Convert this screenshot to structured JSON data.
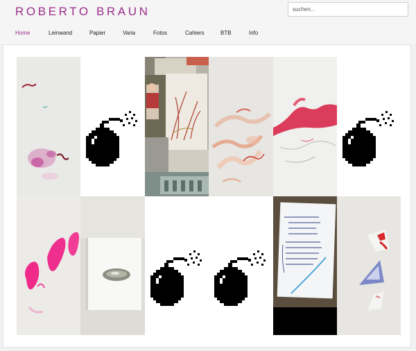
{
  "site": {
    "title": "ROBERTO BRAUN",
    "search_placeholder": "suchen..."
  },
  "nav": [
    {
      "label": "Home",
      "active": true
    },
    {
      "label": "Leinwand",
      "active": false
    },
    {
      "label": "Papier",
      "active": false
    },
    {
      "label": "Varia",
      "active": false
    },
    {
      "label": "Fotos",
      "active": false
    },
    {
      "label": "Cahiers",
      "active": false
    },
    {
      "label": "BTB",
      "active": false
    },
    {
      "label": "Info",
      "active": false
    }
  ],
  "colors": {
    "brand": "#9b2c8a",
    "magenta_paint": "#e8207a",
    "ink": "#000000"
  },
  "gallery": [
    {
      "row": 1,
      "items": [
        "painting-pink-smudge",
        "bomb-icon",
        "collage-photos",
        "painting-peach-strokes",
        "painting-red-scribble",
        "bomb-icon"
      ]
    },
    {
      "row": 2,
      "items": [
        "painting-pink-blobs",
        "book-with-oval",
        "bomb-icon",
        "bomb-icon",
        "notebook-handwriting",
        "paper-fragments"
      ]
    }
  ]
}
